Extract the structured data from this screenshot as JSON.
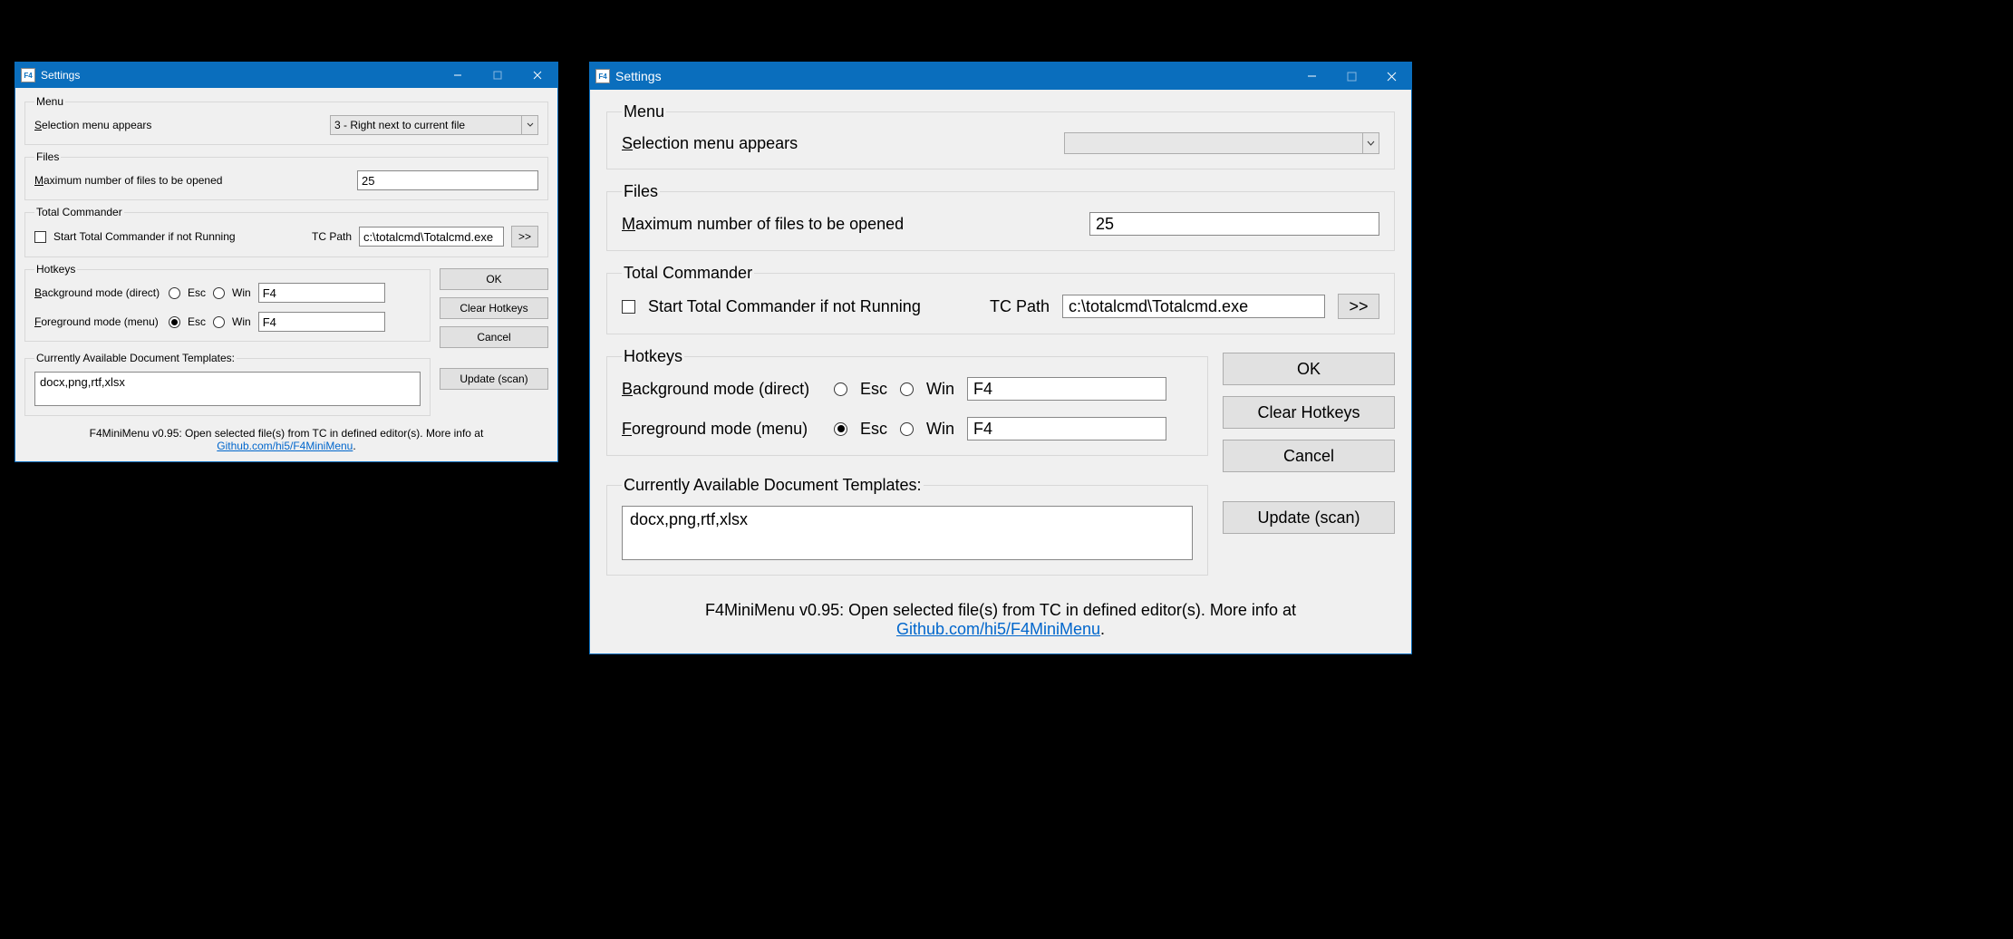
{
  "title": "Settings",
  "menu": {
    "legend": "Menu",
    "selection_label_pre": "S",
    "selection_label_rest": "election menu appears",
    "selection_value_small": "3 - Right next to current file",
    "selection_value_large": ""
  },
  "files": {
    "legend": "Files",
    "max_label_pre": "M",
    "max_label_rest": "aximum number of files to be opened",
    "max_value": "25"
  },
  "tc": {
    "legend": "Total Commander",
    "start_label": "Start Total Commander if not Running",
    "path_label": "TC Path",
    "path_value": "c:\\totalcmd\\Totalcmd.exe",
    "browse": ">>"
  },
  "hotkeys": {
    "legend": "Hotkeys",
    "bg_label_pre": "B",
    "bg_label_rest": "ackground mode (direct)",
    "fg_label_pre": "F",
    "fg_label_rest": "oreground mode (menu)",
    "esc": "Esc",
    "win": "Win",
    "bg_value": "F4",
    "fg_value": "F4"
  },
  "buttons": {
    "ok": "OK",
    "clear": "Clear Hotkeys",
    "cancel": "Cancel",
    "update": "Update (scan)"
  },
  "templates": {
    "legend": "Currently Available Document Templates:",
    "value": "docx,png,rtf,xlsx"
  },
  "footer": {
    "text": "F4MiniMenu v0.95: Open selected file(s) from TC in defined editor(s). More info at ",
    "link": "Github.com/hi5/F4MiniMenu",
    "dot": "."
  }
}
